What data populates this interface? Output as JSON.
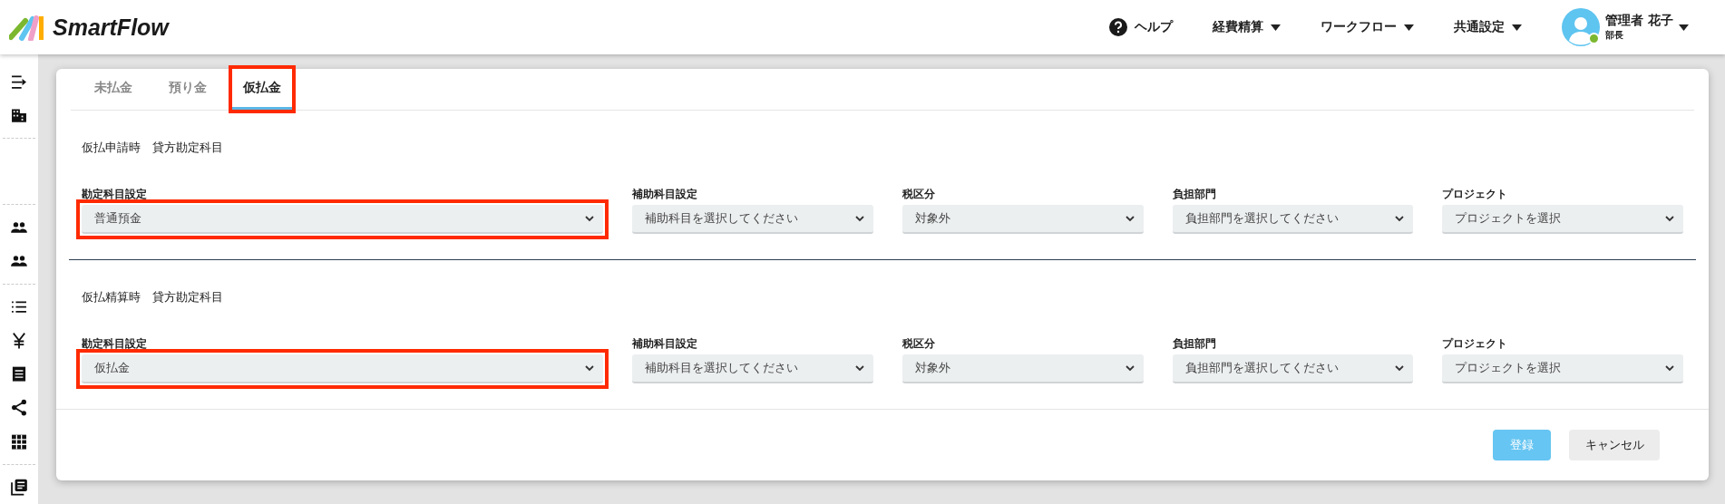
{
  "header": {
    "logo": "SmartFlow",
    "nav": [
      {
        "kind": "help",
        "label": "ヘルプ"
      },
      {
        "kind": "menu",
        "label": "経費精算"
      },
      {
        "kind": "menu",
        "label": "ワークフロー"
      },
      {
        "kind": "menu",
        "label": "共通設定"
      }
    ],
    "user": {
      "name": "管理者 花子",
      "role": "部長",
      "online": true
    }
  },
  "tabs": [
    {
      "label": "未払金",
      "selected": false,
      "highlighted": false
    },
    {
      "label": "預り金",
      "selected": false,
      "highlighted": false
    },
    {
      "label": "仮払金",
      "selected": true,
      "highlighted": true
    }
  ],
  "sections": [
    {
      "title": "仮払申請時　貸方勘定科目",
      "fields": [
        {
          "label": "勘定科目設定",
          "value": "普通預金",
          "highlighted": true
        },
        {
          "label": "補助科目設定",
          "placeholder": "補助科目を選択してください",
          "highlighted": false
        },
        {
          "label": "税区分",
          "value": "対象外",
          "highlighted": false
        },
        {
          "label": "負担部門",
          "placeholder": "負担部門を選択してください",
          "highlighted": false
        },
        {
          "label": "プロジェクト",
          "placeholder": "プロジェクトを選択",
          "highlighted": false
        }
      ]
    },
    {
      "title": "仮払精算時　貸方勘定科目",
      "fields": [
        {
          "label": "勘定科目設定",
          "value": "仮払金",
          "highlighted": true
        },
        {
          "label": "補助科目設定",
          "placeholder": "補助科目を選択してください",
          "highlighted": false
        },
        {
          "label": "税区分",
          "value": "対象外",
          "highlighted": false
        },
        {
          "label": "負担部門",
          "placeholder": "負担部門を選択してください",
          "highlighted": false
        },
        {
          "label": "プロジェクト",
          "placeholder": "プロジェクトを選択",
          "highlighted": false
        }
      ]
    }
  ],
  "buttons": [
    {
      "kind": "primary",
      "label": "登録"
    },
    {
      "kind": "secondary",
      "label": "キャンセル"
    }
  ]
}
